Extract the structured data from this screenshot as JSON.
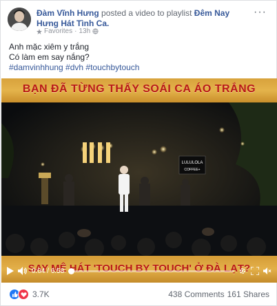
{
  "post": {
    "author": "Đàm Vĩnh Hưng",
    "action": " posted a video to playlist ",
    "playlist": "Đêm Nay Hưng Hát Tình Ca.",
    "audience": "Favorites",
    "time": "13h",
    "text_line1": "Anh mặc xiêm y trắng",
    "text_line2": "Có làm em say nắng?",
    "hashtags": "#damvinhhung #dvh #touchbytouch",
    "more_glyph": "···"
  },
  "video": {
    "banner_top": "BẠN ĐÃ TỪNG THẤY SOÁI CA ÁO TRẮNG",
    "banner_bottom": "SAY MÊ HÁT 'TOUCH BY TOUCH' Ở ĐÀ LẠT?",
    "stage_sign": "LULULOLA",
    "stage_sign2": "COFFEE+",
    "time_current": "0:04",
    "time_total": "6:58",
    "progress_fraction": 0.01
  },
  "stats": {
    "reactions": "3.7K",
    "comments": "438 Comments",
    "shares": "161 Shares"
  },
  "colors": {
    "link": "#365899",
    "like": "#2078f4",
    "love": "#f0364a",
    "banner_text": "#b81818",
    "banner_gold": "#e0ad47"
  }
}
